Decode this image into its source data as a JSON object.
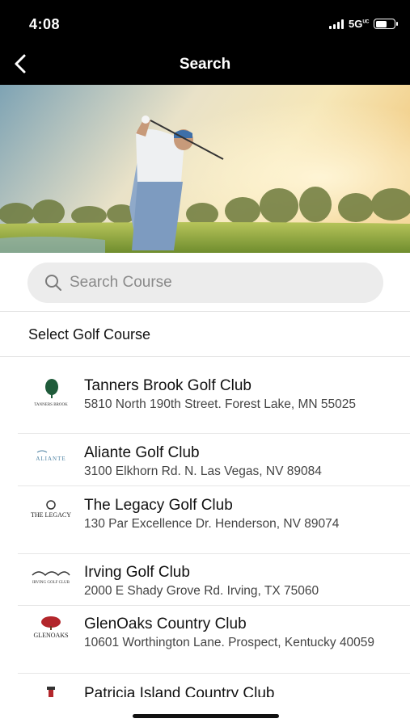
{
  "status": {
    "time": "4:08",
    "network": "5G",
    "network_suffix": "UC"
  },
  "nav": {
    "title": "Search",
    "back_icon": "chevron-left-icon"
  },
  "search": {
    "placeholder": "Search Course",
    "value": "",
    "icon": "search-icon"
  },
  "section": {
    "title": "Select Golf Course"
  },
  "courses": [
    {
      "name": "Tanners Brook Golf Club",
      "address": "5810 North 190th Street. Forest Lake, MN 55025",
      "logo_text": "TANNERS BROOK"
    },
    {
      "name": "Aliante Golf Club",
      "address": "3100 Elkhorn Rd. N. Las Vegas, NV 89084",
      "logo_text": "ALIANTE"
    },
    {
      "name": "The Legacy Golf Club",
      "address": "130 Par Excellence Dr. Henderson, NV 89074",
      "logo_text": "THE LEGACY"
    },
    {
      "name": "Irving Golf Club",
      "address": "2000 E Shady Grove Rd. Irving, TX 75060",
      "logo_text": "IRVING GOLF CLUB"
    },
    {
      "name": "GlenOaks Country Club",
      "address": "10601 Worthington Lane. Prospect, Kentucky 40059",
      "logo_text": "GLENOAKS"
    },
    {
      "name": "Patricia Island Country Club",
      "address": "",
      "logo_text": ""
    }
  ],
  "colors": {
    "topbar": "#000000",
    "search_bg": "#ececec",
    "divider": "#e2e2e2",
    "glenoaks_red": "#b3262b",
    "tanners_green": "#1f5b3a"
  }
}
